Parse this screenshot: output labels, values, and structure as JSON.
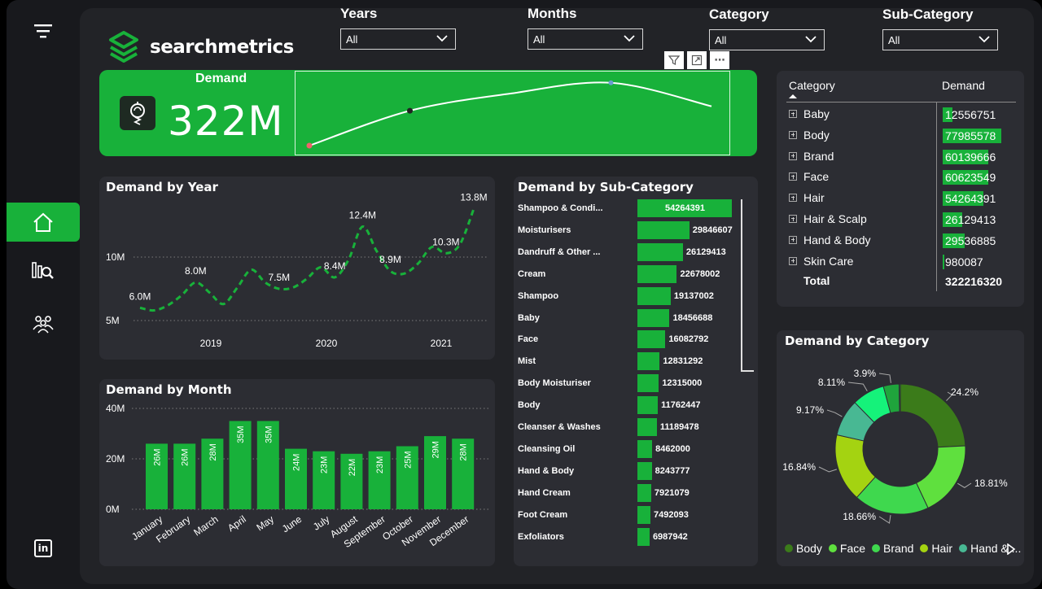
{
  "brand": {
    "name": "searchmetrics",
    "color": "#18b13a"
  },
  "nav": {
    "items": [
      {
        "name": "filter-icon"
      },
      {
        "name": "home-icon",
        "active": true
      },
      {
        "name": "analytics-icon"
      },
      {
        "name": "team-icon"
      },
      {
        "name": "linkedin-icon",
        "label": "in"
      }
    ]
  },
  "slicers": [
    {
      "label": "Years",
      "value": "All"
    },
    {
      "label": "Months",
      "value": "All"
    },
    {
      "label": "Category",
      "value": "All"
    },
    {
      "label": "Sub-Category",
      "value": "All"
    }
  ],
  "visual_header": {
    "icons": [
      "filter-icon",
      "focus-mode-icon",
      "more-options-icon"
    ],
    "more_label": "⋯"
  },
  "kpi": {
    "label": "Demand",
    "value": "322M",
    "icon": "demand-gauge-icon",
    "sparkline": [
      0.0,
      0.55,
      0.82,
      0.99,
      0.62
    ]
  },
  "demand_table": {
    "headers": {
      "category": "Category",
      "demand": "Demand"
    },
    "rows": [
      {
        "category": "Baby",
        "demand": "12556751",
        "value": 12556751
      },
      {
        "category": "Body",
        "demand": "77985578",
        "value": 77985578
      },
      {
        "category": "Brand",
        "demand": "60139666",
        "value": 60139666
      },
      {
        "category": "Face",
        "demand": "60623549",
        "value": 60623549
      },
      {
        "category": "Hair",
        "demand": "54264391",
        "value": 54264391
      },
      {
        "category": "Hair & Scalp",
        "demand": "26129413",
        "value": 26129413
      },
      {
        "category": "Hand & Body",
        "demand": "29536885",
        "value": 29536885
      },
      {
        "category": "Skin Care",
        "demand": "980087",
        "value": 980087
      }
    ],
    "total": {
      "label": "Total",
      "value": "322216320"
    }
  },
  "chart_data": [
    {
      "type": "line",
      "title": "Demand by Year",
      "x_ticks": [
        "2019",
        "2020",
        "2021"
      ],
      "y_ticks": [
        "10M",
        "5M"
      ],
      "ylim": [
        0,
        17
      ],
      "points": [
        6.0,
        5.8,
        6.2,
        7.0,
        8.0,
        7.2,
        6.3,
        7.6,
        9.0,
        8.0,
        7.5,
        7.6,
        8.3,
        9.2,
        8.4,
        9.8,
        12.4,
        10.5,
        8.9,
        8.7,
        9.5,
        10.8,
        10.3,
        11.0,
        13.8
      ],
      "labels": [
        {
          "i": 0,
          "text": "6.0M"
        },
        {
          "i": 4,
          "text": "8.0M"
        },
        {
          "i": 10,
          "text": "7.5M"
        },
        {
          "i": 14,
          "text": "8.4M"
        },
        {
          "i": 16,
          "text": "12.4M"
        },
        {
          "i": 18,
          "text": "8.9M"
        },
        {
          "i": 22,
          "text": "10.3M"
        },
        {
          "i": 24,
          "text": "13.8M"
        }
      ]
    },
    {
      "type": "bar",
      "title": "Demand by Month",
      "categories": [
        "January",
        "February",
        "March",
        "April",
        "May",
        "June",
        "July",
        "August",
        "September",
        "October",
        "November",
        "December"
      ],
      "values": [
        26,
        26,
        28,
        35,
        35,
        24,
        23,
        22,
        23,
        25,
        29,
        28
      ],
      "value_labels": [
        "26M",
        "26M",
        "28M",
        "35M",
        "35M",
        "24M",
        "23M",
        "22M",
        "23M",
        "25M",
        "29M",
        "28M"
      ],
      "y_ticks": [
        "40M",
        "20M",
        "0M"
      ],
      "ylim": [
        0,
        40
      ]
    },
    {
      "type": "bar",
      "orientation": "horizontal",
      "title": "Demand by Sub-Category",
      "categories": [
        "Shampoo & Condi...",
        "Moisturisers",
        "Dandruff & Other ...",
        "Cream",
        "Shampoo",
        "Baby",
        "Face",
        "Mist",
        "Body Moisturiser",
        "Body",
        "Cleanser & Washes",
        "Cleansing Oil",
        "Hand & Body",
        "Hand Cream",
        "Foot Cream",
        "Exfoliators"
      ],
      "values": [
        54264391,
        29846607,
        26129413,
        22678002,
        19137002,
        18456688,
        16082792,
        12831292,
        12315000,
        11762447,
        11189478,
        8462000,
        8243777,
        7921079,
        7492093,
        6987942
      ],
      "value_labels": [
        "54264391",
        "29846607",
        "26129413",
        "22678002",
        "19137002",
        "18456688",
        "16082792",
        "12831292",
        "12315000",
        "11762447",
        "11189478",
        "8462000",
        "8243777",
        "7921079",
        "7492093",
        "6987942"
      ]
    },
    {
      "type": "pie",
      "title": "Demand by Category",
      "slices": [
        {
          "name": "Body",
          "pct": 24.2,
          "label": "24.2%",
          "color": "#3b7b1a"
        },
        {
          "name": "Face",
          "pct": 18.81,
          "label": "18.81%",
          "color": "#5fe03e"
        },
        {
          "name": "Brand",
          "pct": 18.66,
          "label": "18.66%",
          "color": "#3fd84e"
        },
        {
          "name": "Hair",
          "pct": 16.84,
          "label": "16.84%",
          "color": "#a4d311"
        },
        {
          "name": "Hand & ...",
          "pct": 9.17,
          "label": "9.17%",
          "color": "#48b893"
        },
        {
          "name": "",
          "pct": 8.11,
          "label": "8.11%",
          "color": "#15f27a"
        },
        {
          "name": "",
          "pct": 3.9,
          "label": "3.9%",
          "color": "#1fa43c"
        },
        {
          "name": "",
          "pct": 0.31,
          "label": "",
          "color": "#2c7a3c"
        }
      ],
      "legend": [
        "Body",
        "Face",
        "Brand",
        "Hair",
        "Hand & ..."
      ]
    }
  ]
}
